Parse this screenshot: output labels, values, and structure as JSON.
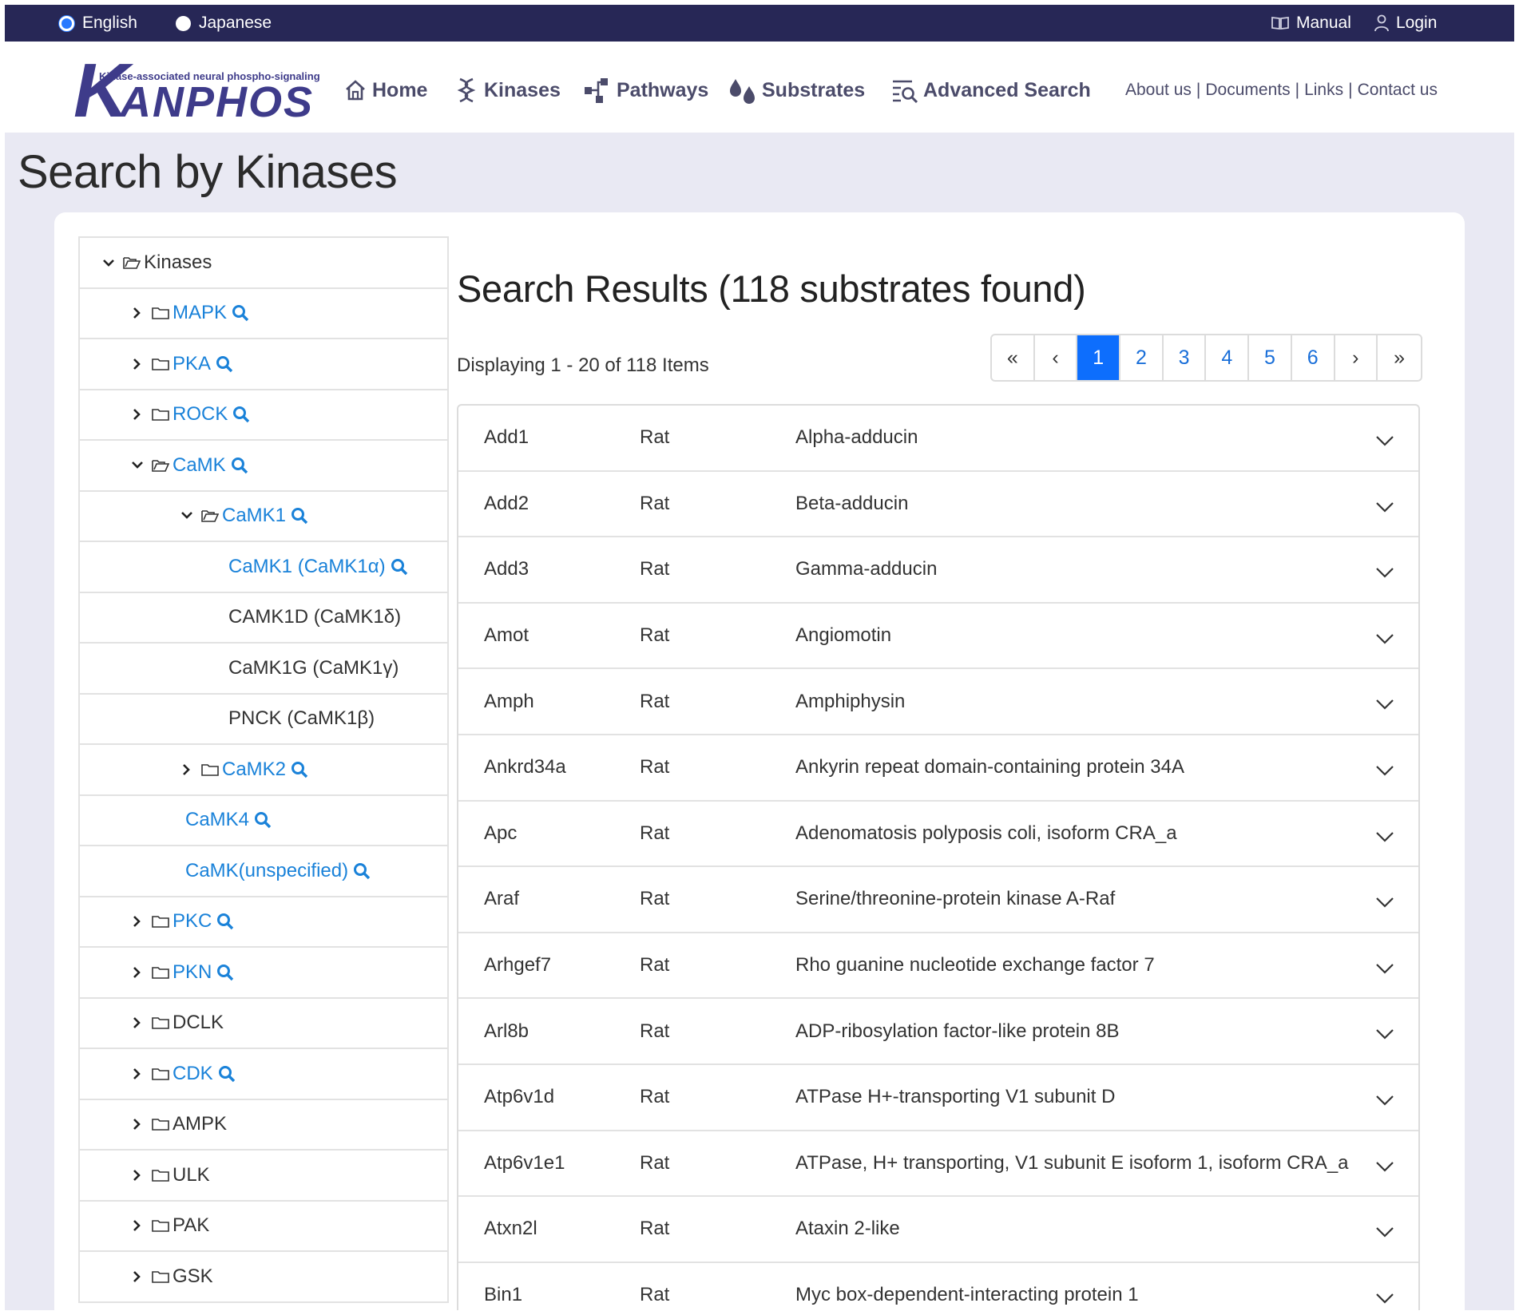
{
  "topbar": {
    "lang_english": "English",
    "lang_japanese": "Japanese",
    "manual": "Manual",
    "login": "Login"
  },
  "logo": {
    "tagline": "Kinase-associated neural phospho-signaling",
    "name": "KANPHOS"
  },
  "nav": {
    "home": "Home",
    "kinases": "Kinases",
    "pathways": "Pathways",
    "substrates": "Substrates",
    "advanced_search": "Advanced Search",
    "about": "About us",
    "documents": "Documents",
    "links": "Links",
    "contact": "Contact us",
    "separator": "|"
  },
  "page_title": "Search by Kinases",
  "tree": {
    "root": "Kinases",
    "items": [
      {
        "label": "MAPK",
        "level": 1,
        "chevron": "right",
        "folder": "closed",
        "link": true,
        "search": true
      },
      {
        "label": "PKA",
        "level": 1,
        "chevron": "right",
        "folder": "closed",
        "link": true,
        "search": true
      },
      {
        "label": "ROCK",
        "level": 1,
        "chevron": "right",
        "folder": "closed",
        "link": true,
        "search": true
      },
      {
        "label": "CaMK",
        "level": 1,
        "chevron": "down",
        "folder": "open",
        "link": true,
        "search": true
      },
      {
        "label": "CaMK1",
        "level": 2,
        "chevron": "down",
        "folder": "open",
        "link": true,
        "search": true
      },
      {
        "label": "CaMK1 (CaMK1α)",
        "level": 3,
        "chevron": "none",
        "folder": "none",
        "link": true,
        "search": true
      },
      {
        "label": "CAMK1D (CaMK1δ)",
        "level": 3,
        "chevron": "none",
        "folder": "none",
        "link": false,
        "search": false
      },
      {
        "label": "CaMK1G (CaMK1γ)",
        "level": 3,
        "chevron": "none",
        "folder": "none",
        "link": false,
        "search": false
      },
      {
        "label": "PNCK (CaMK1β)",
        "level": 3,
        "chevron": "none",
        "folder": "none",
        "link": false,
        "search": false
      },
      {
        "label": "CaMK2",
        "level": 2,
        "chevron": "right",
        "folder": "closed",
        "link": true,
        "search": true
      },
      {
        "label": "CaMK4",
        "level": 2.5,
        "chevron": "none",
        "folder": "none",
        "link": true,
        "search": true
      },
      {
        "label": "CaMK(unspecified)",
        "level": 2.5,
        "chevron": "none",
        "folder": "none",
        "link": true,
        "search": true
      },
      {
        "label": "PKC",
        "level": 1,
        "chevron": "right",
        "folder": "closed",
        "link": true,
        "search": true
      },
      {
        "label": "PKN",
        "level": 1,
        "chevron": "right",
        "folder": "closed",
        "link": true,
        "search": true
      },
      {
        "label": "DCLK",
        "level": 1,
        "chevron": "right",
        "folder": "closed",
        "link": false,
        "search": false
      },
      {
        "label": "CDK",
        "level": 1,
        "chevron": "right",
        "folder": "closed",
        "link": true,
        "search": true
      },
      {
        "label": "AMPK",
        "level": 1,
        "chevron": "right",
        "folder": "closed",
        "link": false,
        "search": false
      },
      {
        "label": "ULK",
        "level": 1,
        "chevron": "right",
        "folder": "closed",
        "link": false,
        "search": false
      },
      {
        "label": "PAK",
        "level": 1,
        "chevron": "right",
        "folder": "closed",
        "link": false,
        "search": false
      },
      {
        "label": "GSK",
        "level": 1,
        "chevron": "right",
        "folder": "closed",
        "link": false,
        "search": false
      }
    ]
  },
  "results": {
    "title": "Search Results (118 substrates found)",
    "displaying": "Displaying 1 - 20 of 118 Items",
    "pager": [
      "«",
      "‹",
      "1",
      "2",
      "3",
      "4",
      "5",
      "6",
      "›",
      "»"
    ],
    "active_page": "1",
    "rows": [
      {
        "gene": "Add1",
        "species": "Rat",
        "name": "Alpha-adducin"
      },
      {
        "gene": "Add2",
        "species": "Rat",
        "name": "Beta-adducin"
      },
      {
        "gene": "Add3",
        "species": "Rat",
        "name": "Gamma-adducin"
      },
      {
        "gene": "Amot",
        "species": "Rat",
        "name": "Angiomotin"
      },
      {
        "gene": "Amph",
        "species": "Rat",
        "name": "Amphiphysin"
      },
      {
        "gene": "Ankrd34a",
        "species": "Rat",
        "name": "Ankyrin repeat domain-containing protein 34A"
      },
      {
        "gene": "Apc",
        "species": "Rat",
        "name": "Adenomatosis polyposis coli, isoform CRA_a"
      },
      {
        "gene": "Araf",
        "species": "Rat",
        "name": "Serine/threonine-protein kinase A-Raf"
      },
      {
        "gene": "Arhgef7",
        "species": "Rat",
        "name": "Rho guanine nucleotide exchange factor 7"
      },
      {
        "gene": "Arl8b",
        "species": "Rat",
        "name": "ADP-ribosylation factor-like protein 8B"
      },
      {
        "gene": "Atp6v1d",
        "species": "Rat",
        "name": "ATPase H+-transporting V1 subunit D"
      },
      {
        "gene": "Atp6v1e1",
        "species": "Rat",
        "name": "ATPase, H+ transporting, V1 subunit E isoform 1, isoform CRA_a"
      },
      {
        "gene": "Atxn2l",
        "species": "Rat",
        "name": "Ataxin 2-like"
      },
      {
        "gene": "Bin1",
        "species": "Rat",
        "name": "Myc box-dependent-interacting protein 1"
      }
    ]
  },
  "colors": {
    "topbar": "#272756",
    "link": "#1a82d9",
    "active_page": "#0d6efd",
    "nav_text": "#4b4b6a",
    "page_bg": "#e9e9f3"
  }
}
